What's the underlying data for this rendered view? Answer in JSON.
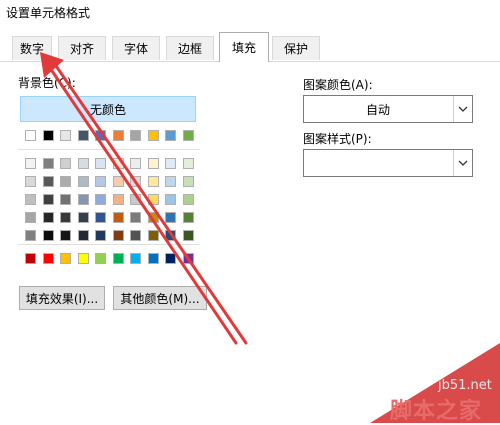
{
  "dialog": {
    "title": "设置单元格格式"
  },
  "tabs": [
    {
      "label": "数字",
      "active": false
    },
    {
      "label": "对齐",
      "active": false
    },
    {
      "label": "字体",
      "active": false
    },
    {
      "label": "边框",
      "active": false
    },
    {
      "label": "填充",
      "active": true
    },
    {
      "label": "保护",
      "active": false
    }
  ],
  "fill": {
    "background_label": "背景色(C):",
    "no_color_label": "无颜色",
    "fill_effects_label": "填充效果(I)...",
    "more_colors_label": "其他颜色(M)..."
  },
  "palette": {
    "theme_row": [
      "#ffffff",
      "#000000",
      "#e7e6e6",
      "#44546a",
      "#4472c4",
      "#ed7d31",
      "#a5a5a5",
      "#ffc000",
      "#5b9bd5",
      "#70ad47"
    ],
    "shade_rows": [
      [
        "#f2f2f2",
        "#7f7f7f",
        "#d0cece",
        "#d6dce4",
        "#dae3f3",
        "#fbe5d6",
        "#ededed",
        "#fff2cc",
        "#deebf7",
        "#e2f0d9"
      ],
      [
        "#d9d9d9",
        "#595959",
        "#aeabab",
        "#adb9ca",
        "#b4c7e7",
        "#f8cbad",
        "#dbdbdb",
        "#ffe699",
        "#bdd7ee",
        "#c5e0b4"
      ],
      [
        "#bfbfbf",
        "#404040",
        "#757171",
        "#8497b0",
        "#8faadc",
        "#f4b183",
        "#c9c9c9",
        "#ffd966",
        "#9dc3e6",
        "#a9d18e"
      ],
      [
        "#a6a6a6",
        "#262626",
        "#3a3838",
        "#333f50",
        "#2f5597",
        "#c55a11",
        "#7b7b7b",
        "#bf9000",
        "#2e75b6",
        "#548235"
      ],
      [
        "#808080",
        "#0d0d0d",
        "#171616",
        "#222a35",
        "#203864",
        "#843c0c",
        "#525252",
        "#7f6000",
        "#1f4e79",
        "#385723"
      ]
    ],
    "standard_row": [
      "#c00000",
      "#ff0000",
      "#ffc000",
      "#ffff00",
      "#92d050",
      "#00b050",
      "#00b0f0",
      "#0070c0",
      "#002060",
      "#7030a0"
    ]
  },
  "pattern": {
    "color_label": "图案颜色(A):",
    "color_value": "自动",
    "style_label": "图案样式(P):",
    "style_value": ""
  },
  "annotation": {
    "arrow_color": "#e03a3a"
  },
  "watermark": {
    "site": "jb51.net",
    "brand": "脚本之家"
  }
}
